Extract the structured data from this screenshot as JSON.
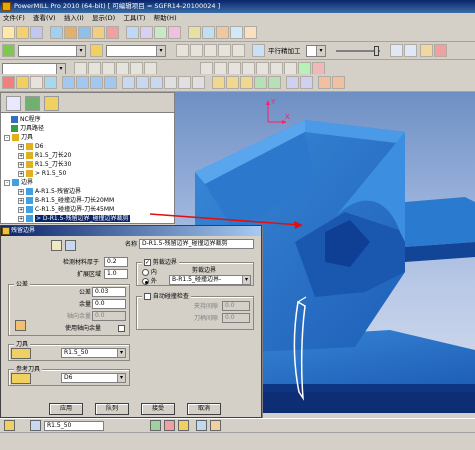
{
  "window": {
    "title": "PowerMILL Pro 2010 (64-bit)   [ 可编辑项目 = SGFR14-20100024 ]"
  },
  "menu": [
    "文件(F)",
    "查看(V)",
    "插入(I)",
    "显示(D)",
    "工具(T)",
    "帮助(H)"
  ],
  "toolbar2": {
    "strategy_label": "平行精加工"
  },
  "explorer": {
    "items": [
      {
        "label": "NC程序",
        "indent": 1,
        "toggle": "",
        "icon": "nc-program-icon"
      },
      {
        "label": "刀具路径",
        "indent": 1,
        "toggle": "",
        "icon": "toolpath-icon"
      },
      {
        "label": "刀具",
        "indent": 0,
        "toggle": "-",
        "icon": "tool-icon"
      },
      {
        "label": "D6",
        "indent": 2,
        "toggle": "+",
        "icon": "tool-icon"
      },
      {
        "label": "R1.5_刀长20",
        "indent": 2,
        "toggle": "+",
        "icon": "tool-icon"
      },
      {
        "label": "R1.5_刀长30",
        "indent": 2,
        "toggle": "+",
        "icon": "tool-icon"
      },
      {
        "label": "> R1.5_50",
        "indent": 2,
        "toggle": "+",
        "icon": "tool-icon"
      },
      {
        "label": "边界",
        "indent": 0,
        "toggle": "-",
        "icon": "boundary-icon"
      },
      {
        "label": "A-R1.5-残留边界",
        "indent": 2,
        "toggle": "+",
        "icon": "boundary-icon"
      },
      {
        "label": "B-R1.5_碰撞边界-刀长20MM",
        "indent": 2,
        "toggle": "+",
        "icon": "boundary-icon"
      },
      {
        "label": "C-R1.5_碰撞边界-刀长45MM",
        "indent": 2,
        "toggle": "+",
        "icon": "boundary-icon"
      },
      {
        "label": "> D-R1.5-残留边界_碰撞边界裁剪",
        "indent": 2,
        "toggle": "+",
        "icon": "boundary-icon"
      }
    ]
  },
  "dialog": {
    "title": "残留边界",
    "name_label": "名称",
    "name_value": "D-R1.5-残留边界_碰撞边界裁剪",
    "detect_thickness_label": "检测材料厚于",
    "detect_thickness_value": "0.2",
    "expand_label": "扩展区域",
    "expand_value": "1.0",
    "tolerance_group": "公差",
    "tolerance_label": "公差",
    "tolerance_value": "0.03",
    "allowance_label": "余量",
    "allowance_value": "0.0",
    "axial_label": "轴向余量",
    "axial_value": "0.0",
    "use_axial_label": "使用轴向余量",
    "trim_group_label": "剪裁边界",
    "trim_checked": "✓",
    "inside_label": "内",
    "outside_label": "外",
    "trim_boundary_label": "剪裁边界",
    "trim_boundary_value": "B-R1.5_碰撞边界-",
    "auto_collision_label": "自动碰撞检查",
    "holder_clearance_label": "夹持间隙",
    "holder_clearance_value": "0.0",
    "shank_clearance_label": "刀柄间隙",
    "shank_clearance_value": "0.0",
    "tool_group": "刀具",
    "tool_value": "R1.5_50",
    "ref_tool_group": "参考刀具",
    "ref_tool_value": "D6",
    "buttons": [
      "应用",
      "队列",
      "接受",
      "取消"
    ]
  },
  "statusbar": {
    "tool_value": "R1.5_50"
  },
  "viewport": {
    "axis_x": "X",
    "axis_y": "Y"
  }
}
